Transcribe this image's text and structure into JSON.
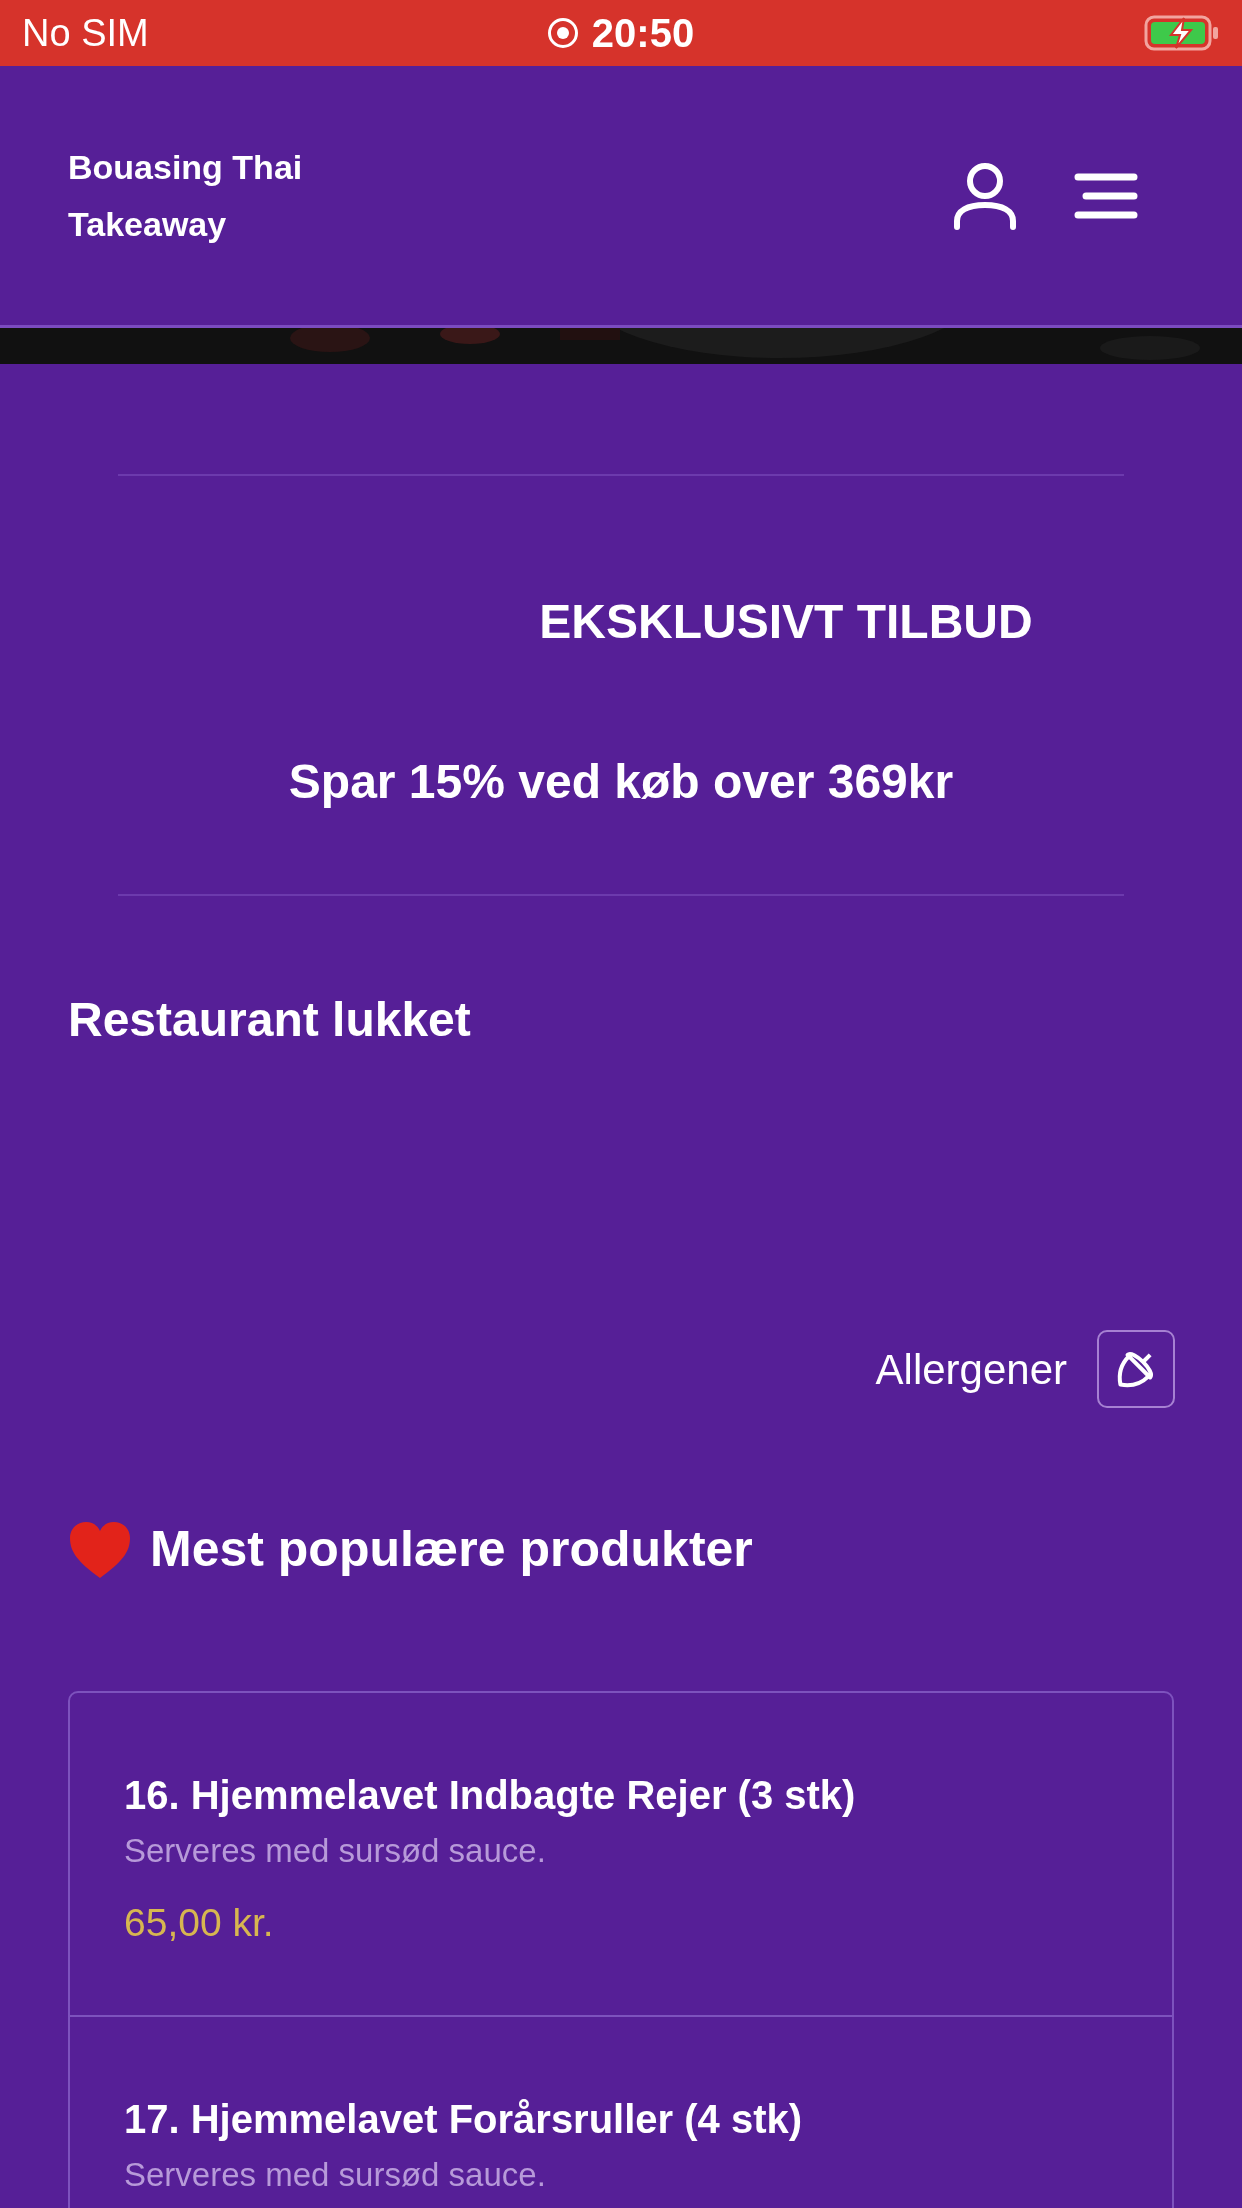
{
  "status_bar": {
    "carrier": "No SIM",
    "time": "20:50"
  },
  "header": {
    "title": "Bouasing Thai Takeaway"
  },
  "offer": {
    "title": "EKSKLUSIVT TILBUD",
    "text": "Spar 15% ved køb over 369kr"
  },
  "status_message": "Restaurant lukket",
  "allergens": {
    "label": "Allergener"
  },
  "popular": {
    "title": "Mest populære produkter",
    "products": [
      {
        "name": "16. Hjemmelavet Indbagte Rejer (3 stk)",
        "description": "Serveres med sursød sauce.",
        "price": "65,00 kr."
      },
      {
        "name": "17. Hjemmelavet Forårsruller (4 stk)",
        "description": "Serveres med sursød sauce."
      }
    ]
  }
}
